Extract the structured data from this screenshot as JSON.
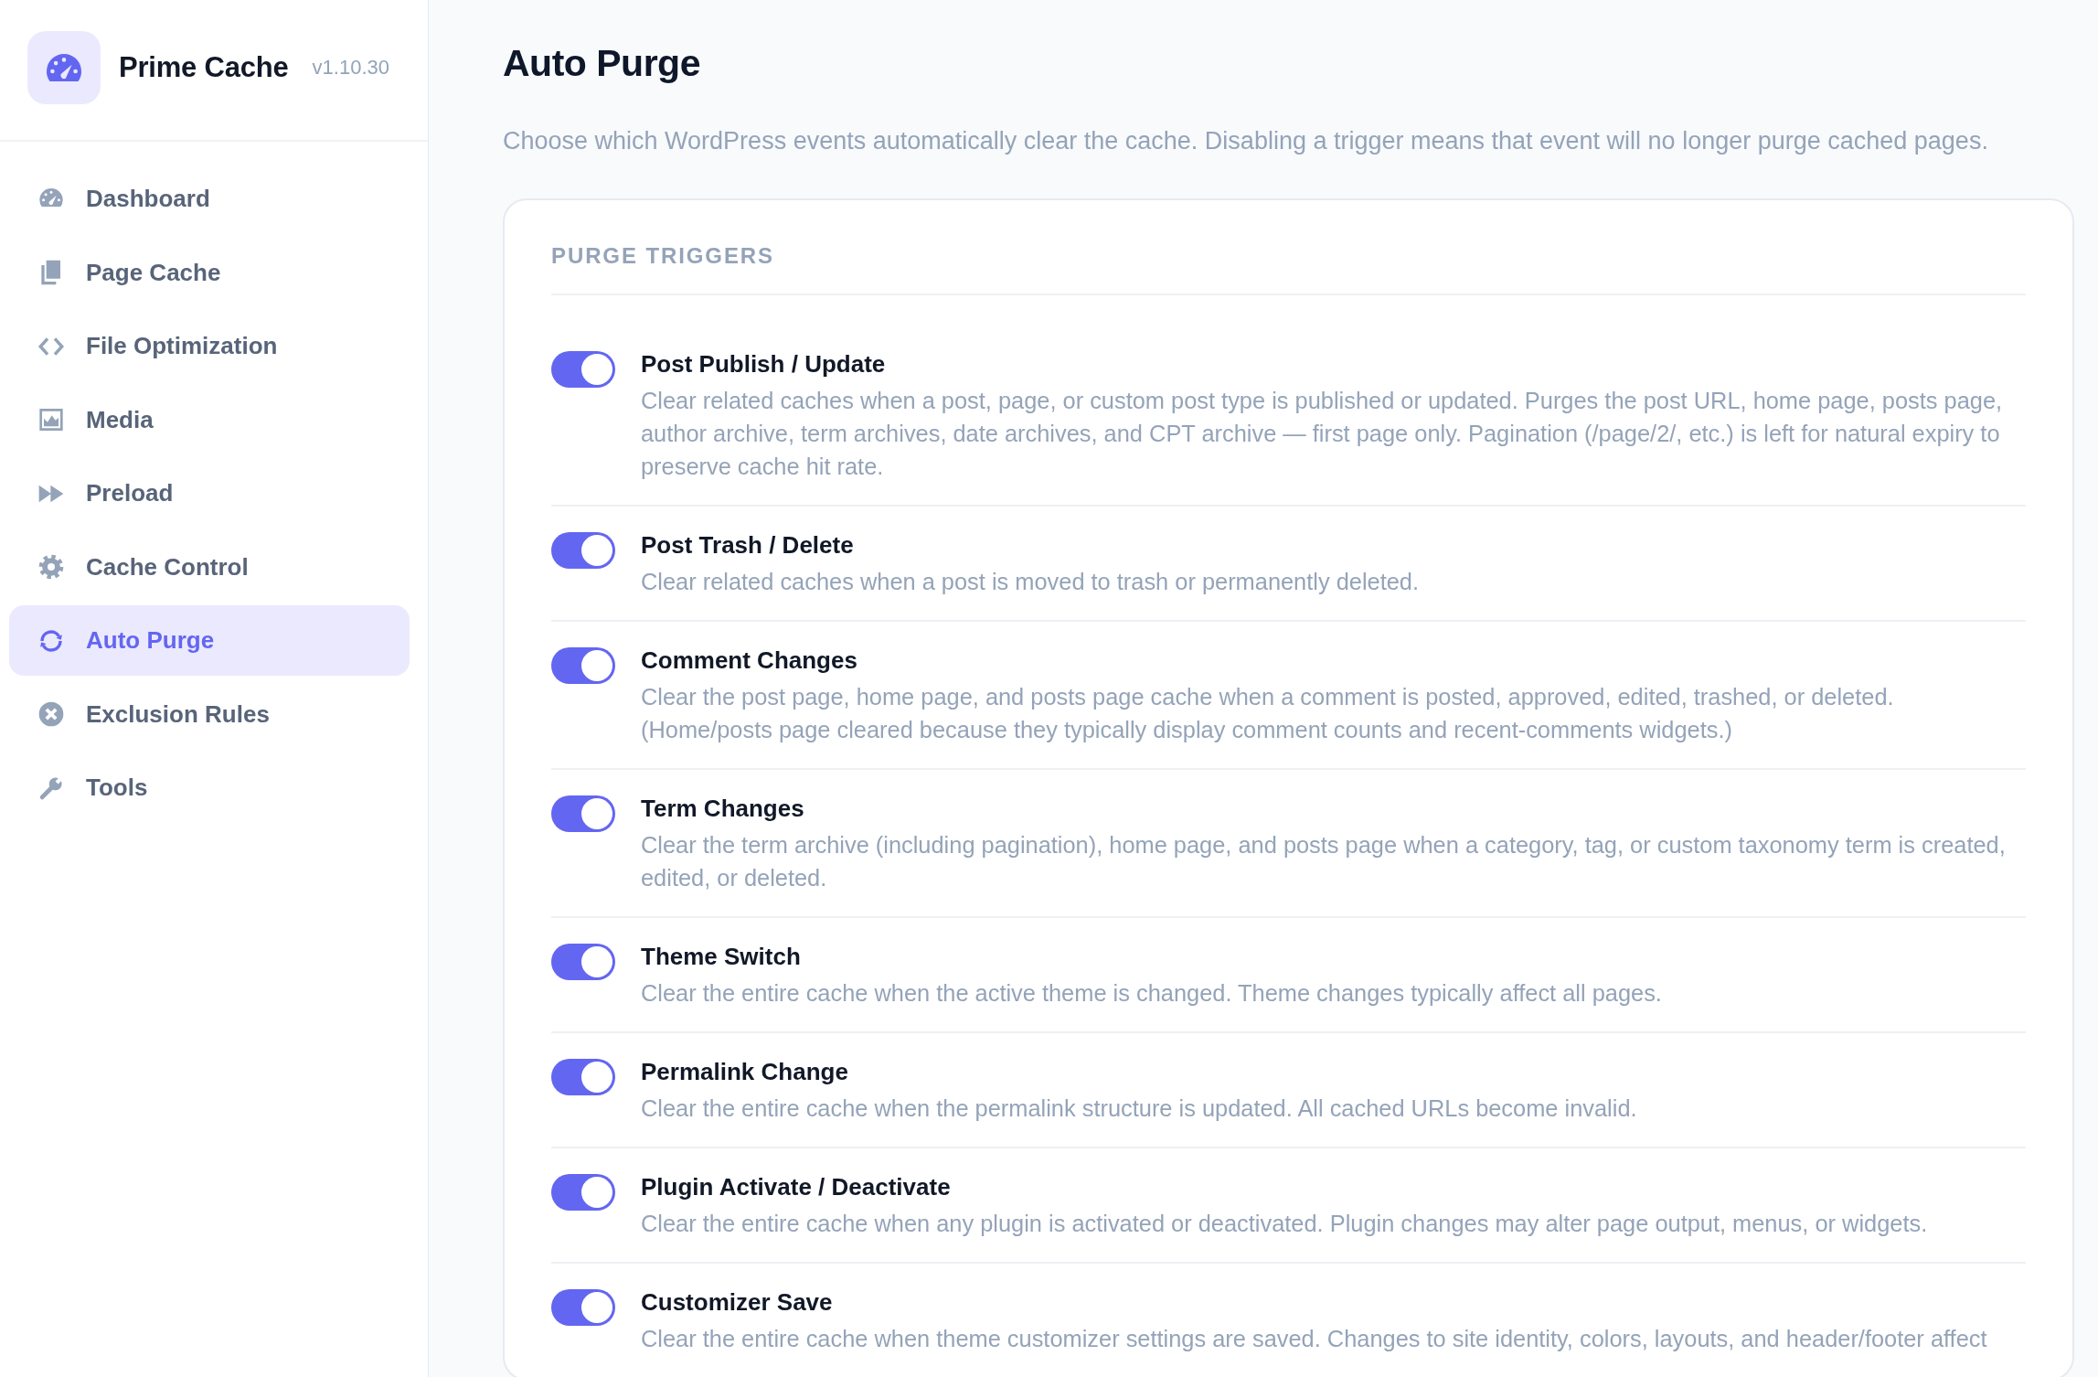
{
  "sidebar": {
    "app_name": "Prime Cache",
    "version": "v1.10.30",
    "nav_items": [
      {
        "label": "Dashboard",
        "selected": false
      },
      {
        "label": "Page Cache",
        "selected": false
      },
      {
        "label": "File Optimization",
        "selected": false
      },
      {
        "label": "Media",
        "selected": false
      },
      {
        "label": "Preload",
        "selected": false
      },
      {
        "label": "Cache Control",
        "selected": false
      },
      {
        "label": "Auto Purge",
        "selected": true
      },
      {
        "label": "Exclusion Rules",
        "selected": false
      },
      {
        "label": "Tools",
        "selected": false
      }
    ]
  },
  "page": {
    "title": "Auto Purge",
    "description": "Choose which WordPress events automatically clear the cache. Disabling a trigger means that event will no longer purge cached pages."
  },
  "purge_triggers": {
    "heading": "PURGE TRIGGERS",
    "triggers": [
      {
        "title": "Post Publish / Update",
        "description": "Clear related caches when a post, page, or custom post type is published or updated. Purges the post URL, home page, posts page, author archive, term archives, date archives, and CPT archive — first page only. Pagination (/page/2/, etc.) is left for natural expiry to preserve cache hit rate.",
        "on": true
      },
      {
        "title": "Post Trash / Delete",
        "description": "Clear related caches when a post is moved to trash or permanently deleted.",
        "on": true
      },
      {
        "title": "Comment Changes",
        "description": "Clear the post page, home page, and posts page cache when a comment is posted, approved, edited, trashed, or deleted. (Home/posts page cleared because they typically display comment counts and recent-comments widgets.)",
        "on": true
      },
      {
        "title": "Term Changes",
        "description": "Clear the term archive (including pagination), home page, and posts page when a category, tag, or custom taxonomy term is created, edited, or deleted.",
        "on": true
      },
      {
        "title": "Theme Switch",
        "description": "Clear the entire cache when the active theme is changed. Theme changes typically affect all pages.",
        "on": true
      },
      {
        "title": "Permalink Change",
        "description": "Clear the entire cache when the permalink structure is updated. All cached URLs become invalid.",
        "on": true
      },
      {
        "title": "Plugin Activate / Deactivate",
        "description": "Clear the entire cache when any plugin is activated or deactivated. Plugin changes may alter page output, menus, or widgets.",
        "on": true
      },
      {
        "title": "Customizer Save",
        "description": "Clear the entire cache when theme customizer settings are saved. Changes to site identity, colors, layouts, and header/footer affect",
        "on": true
      }
    ]
  }
}
